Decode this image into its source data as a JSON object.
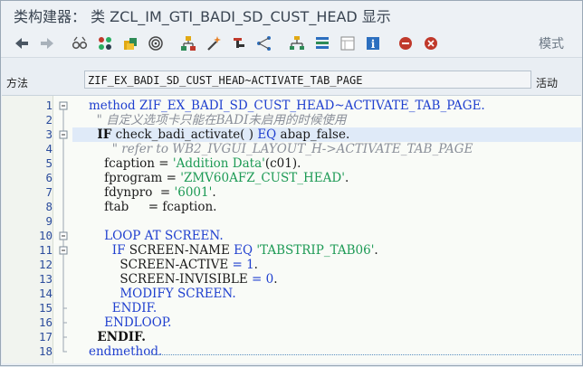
{
  "title": "类构建器：  类 ZCL_IM_GTI_BADI_SD_CUST_HEAD 显示",
  "toolbar": {
    "icons": [
      "back-arrow-icon",
      "forward-arrow-icon",
      "glasses-icon",
      "object-list-icon",
      "other-object-icon",
      "where-used-icon",
      "hierarchy-icon",
      "magic-wand-icon",
      "inspect-icon",
      "network-icon",
      "tree-icon",
      "structure-icon",
      "window-icon",
      "info-icon",
      "debug-stop-icon",
      "breakpoint-icon"
    ],
    "mode_label": "模式"
  },
  "method_field": {
    "label": "方法",
    "value": "ZIF_EX_BADI_SD_CUST_HEAD~ACTIVATE_TAB_PAGE",
    "status": "活动"
  },
  "line_numbers": [
    "1",
    "2",
    "3",
    "4",
    "5",
    "6",
    "7",
    "8",
    "9",
    "10",
    "11",
    "12",
    "13",
    "14",
    "15",
    "16",
    "17",
    "18"
  ],
  "code": [
    {
      "parts": [
        {
          "t": "method",
          "c": "kw"
        },
        {
          "t": " ZIF_EX_BADI_SD_CUST_HEAD~ACTIVATE_TAB_PAGE.",
          "c": "kw"
        }
      ]
    },
    {
      "parts": [
        {
          "t": "  \" 自定义选项卡只能在BADI未启用的时候使用",
          "c": "cm"
        }
      ]
    },
    {
      "parts": [
        {
          "t": "  IF",
          "c": "kwb"
        },
        {
          "t": " check_badi_activate( ) ",
          "c": ""
        },
        {
          "t": "EQ",
          "c": "kw"
        },
        {
          "t": " abap_false.",
          "c": ""
        }
      ]
    },
    {
      "parts": [
        {
          "t": "      \" refer to WB2_IVGUI_LAYOUT_H->ACTIVATE_TAB_PAGE",
          "c": "cm"
        }
      ]
    },
    {
      "parts": [
        {
          "t": "    fcaption = ",
          "c": ""
        },
        {
          "t": "'Addition Data'",
          "c": "str"
        },
        {
          "t": "(c01).",
          "c": ""
        }
      ]
    },
    {
      "parts": [
        {
          "t": "    fprogram = ",
          "c": ""
        },
        {
          "t": "'ZMV60AFZ_CUST_HEAD'",
          "c": "str"
        },
        {
          "t": ".",
          "c": ""
        }
      ]
    },
    {
      "parts": [
        {
          "t": "    fdynpro  = ",
          "c": ""
        },
        {
          "t": "'6001'",
          "c": "str"
        },
        {
          "t": ".",
          "c": ""
        }
      ]
    },
    {
      "parts": [
        {
          "t": "    ftab     = fcaption.",
          "c": ""
        }
      ]
    },
    {
      "parts": []
    },
    {
      "parts": [
        {
          "t": "    LOOP AT SCREEN.",
          "c": "kw"
        }
      ]
    },
    {
      "parts": [
        {
          "t": "      IF",
          "c": "kw"
        },
        {
          "t": " SCREEN-NAME ",
          "c": ""
        },
        {
          "t": "EQ",
          "c": "kw"
        },
        {
          "t": " ",
          "c": ""
        },
        {
          "t": "'TABSTRIP_TAB06'",
          "c": "str"
        },
        {
          "t": ".",
          "c": ""
        }
      ]
    },
    {
      "parts": [
        {
          "t": "        SCREEN-ACTIVE ",
          "c": ""
        },
        {
          "t": "=",
          "c": "op"
        },
        {
          "t": " ",
          "c": ""
        },
        {
          "t": "1",
          "c": "num"
        },
        {
          "t": ".",
          "c": ""
        }
      ]
    },
    {
      "parts": [
        {
          "t": "        SCREEN-INVISIBLE ",
          "c": ""
        },
        {
          "t": "=",
          "c": "op"
        },
        {
          "t": " ",
          "c": ""
        },
        {
          "t": "0",
          "c": "num"
        },
        {
          "t": ".",
          "c": ""
        }
      ]
    },
    {
      "parts": [
        {
          "t": "        MODIFY SCREEN.",
          "c": "kw"
        }
      ]
    },
    {
      "parts": [
        {
          "t": "      ENDIF.",
          "c": "kw"
        }
      ]
    },
    {
      "parts": [
        {
          "t": "    ENDLOOP.",
          "c": "kw"
        }
      ]
    },
    {
      "parts": [
        {
          "t": "  ENDIF.",
          "c": "kwb"
        }
      ]
    },
    {
      "parts": [
        {
          "t": "endmethod.",
          "c": "kw"
        }
      ]
    }
  ],
  "fold_lines": [
    "1",
    "3",
    "10",
    "11"
  ]
}
